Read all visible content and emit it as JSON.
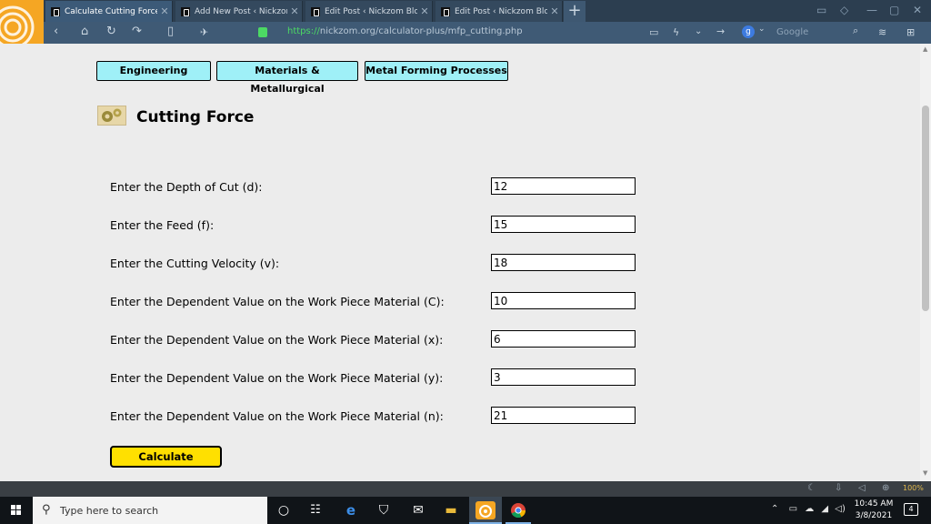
{
  "browser": {
    "tabs": [
      {
        "label": "Calculate Cutting Force",
        "active": true
      },
      {
        "label": "Add New Post ‹ Nickzom",
        "active": false
      },
      {
        "label": "Edit Post ‹ Nickzom Blog",
        "active": false
      },
      {
        "label": "Edit Post ‹ Nickzom Blog",
        "active": false
      }
    ],
    "url_secure": "https://",
    "url_rest": "nickzom.org/calculator-plus/mfp_cutting.php",
    "search_engine_letter": "g",
    "search_placeholder": "Google",
    "zoom": "100%"
  },
  "page": {
    "categories": [
      "Engineering",
      "Materials & Metallurgical",
      "Metal Forming Processes"
    ],
    "title": "Cutting Force",
    "fields": [
      {
        "label": "Enter the Depth of Cut (d):",
        "value": "12"
      },
      {
        "label": "Enter the Feed (f):",
        "value": "15"
      },
      {
        "label": "Enter the Cutting Velocity (v):",
        "value": "18"
      },
      {
        "label": "Enter the Dependent Value on the Work Piece Material (C):",
        "value": "10"
      },
      {
        "label": "Enter the Dependent Value on the Work Piece Material (x):",
        "value": "6"
      },
      {
        "label": "Enter the Dependent Value on the Work Piece Material (y):",
        "value": "3"
      },
      {
        "label": "Enter the Dependent Value on the Work Piece Material (n):",
        "value": "21"
      }
    ],
    "calculate_label": "Calculate"
  },
  "taskbar": {
    "search_placeholder": "Type here to search",
    "time": "10:45 AM",
    "date": "3/8/2021",
    "notification_count": "4",
    "pinned_icons": [
      "task-view-icon",
      "task-manager-icon",
      "edge-icon",
      "store-icon",
      "mail-icon",
      "file-explorer-icon",
      "uc-browser-icon",
      "chrome-icon"
    ]
  },
  "colors": {
    "category_button": "#9ff0f7",
    "calculate_button": "#ffe000",
    "browser_chrome": "#3f5a75",
    "logo_accent": "#f5a623"
  }
}
